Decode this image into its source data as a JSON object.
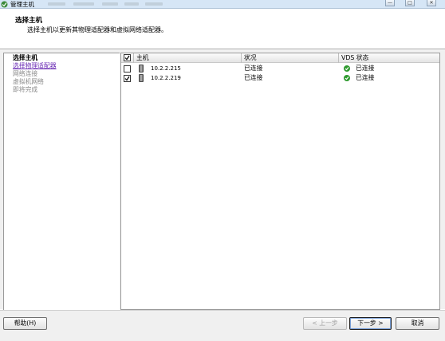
{
  "window": {
    "title": "管理主机"
  },
  "header": {
    "title": "选择主机",
    "subtitle": "选择主机以更新其物理适配器和虚拟网络适配器。"
  },
  "steps": [
    {
      "label": "选择主机",
      "state": "current"
    },
    {
      "label": "选择物理适配器",
      "state": "link"
    },
    {
      "label": "网络连接",
      "state": "disabled"
    },
    {
      "label": "虚拟机网络",
      "state": "disabled"
    },
    {
      "label": "即将完成",
      "state": "disabled"
    }
  ],
  "grid": {
    "columns": {
      "host": "主机",
      "status": "状况",
      "vds_status": "VDS 状态"
    },
    "select_all_checked": true,
    "rows": [
      {
        "checked": false,
        "host": "10.2.2.215",
        "status": "已连接",
        "vds_status": "已连接",
        "icon": "server-icon",
        "vds_icon": "check-circle-icon"
      },
      {
        "checked": true,
        "host": "10.2.2.219",
        "status": "已连接",
        "vds_status": "已连接",
        "icon": "server-icon",
        "vds_icon": "check-circle-icon"
      }
    ]
  },
  "buttons": {
    "help": "帮助(H)",
    "back": "< 上一步",
    "next": "下一步 >",
    "cancel": "取消"
  },
  "colors": {
    "link": "#6a2bb4",
    "ok": "#2f9a2f",
    "titlebar": "#d6e6f6"
  }
}
